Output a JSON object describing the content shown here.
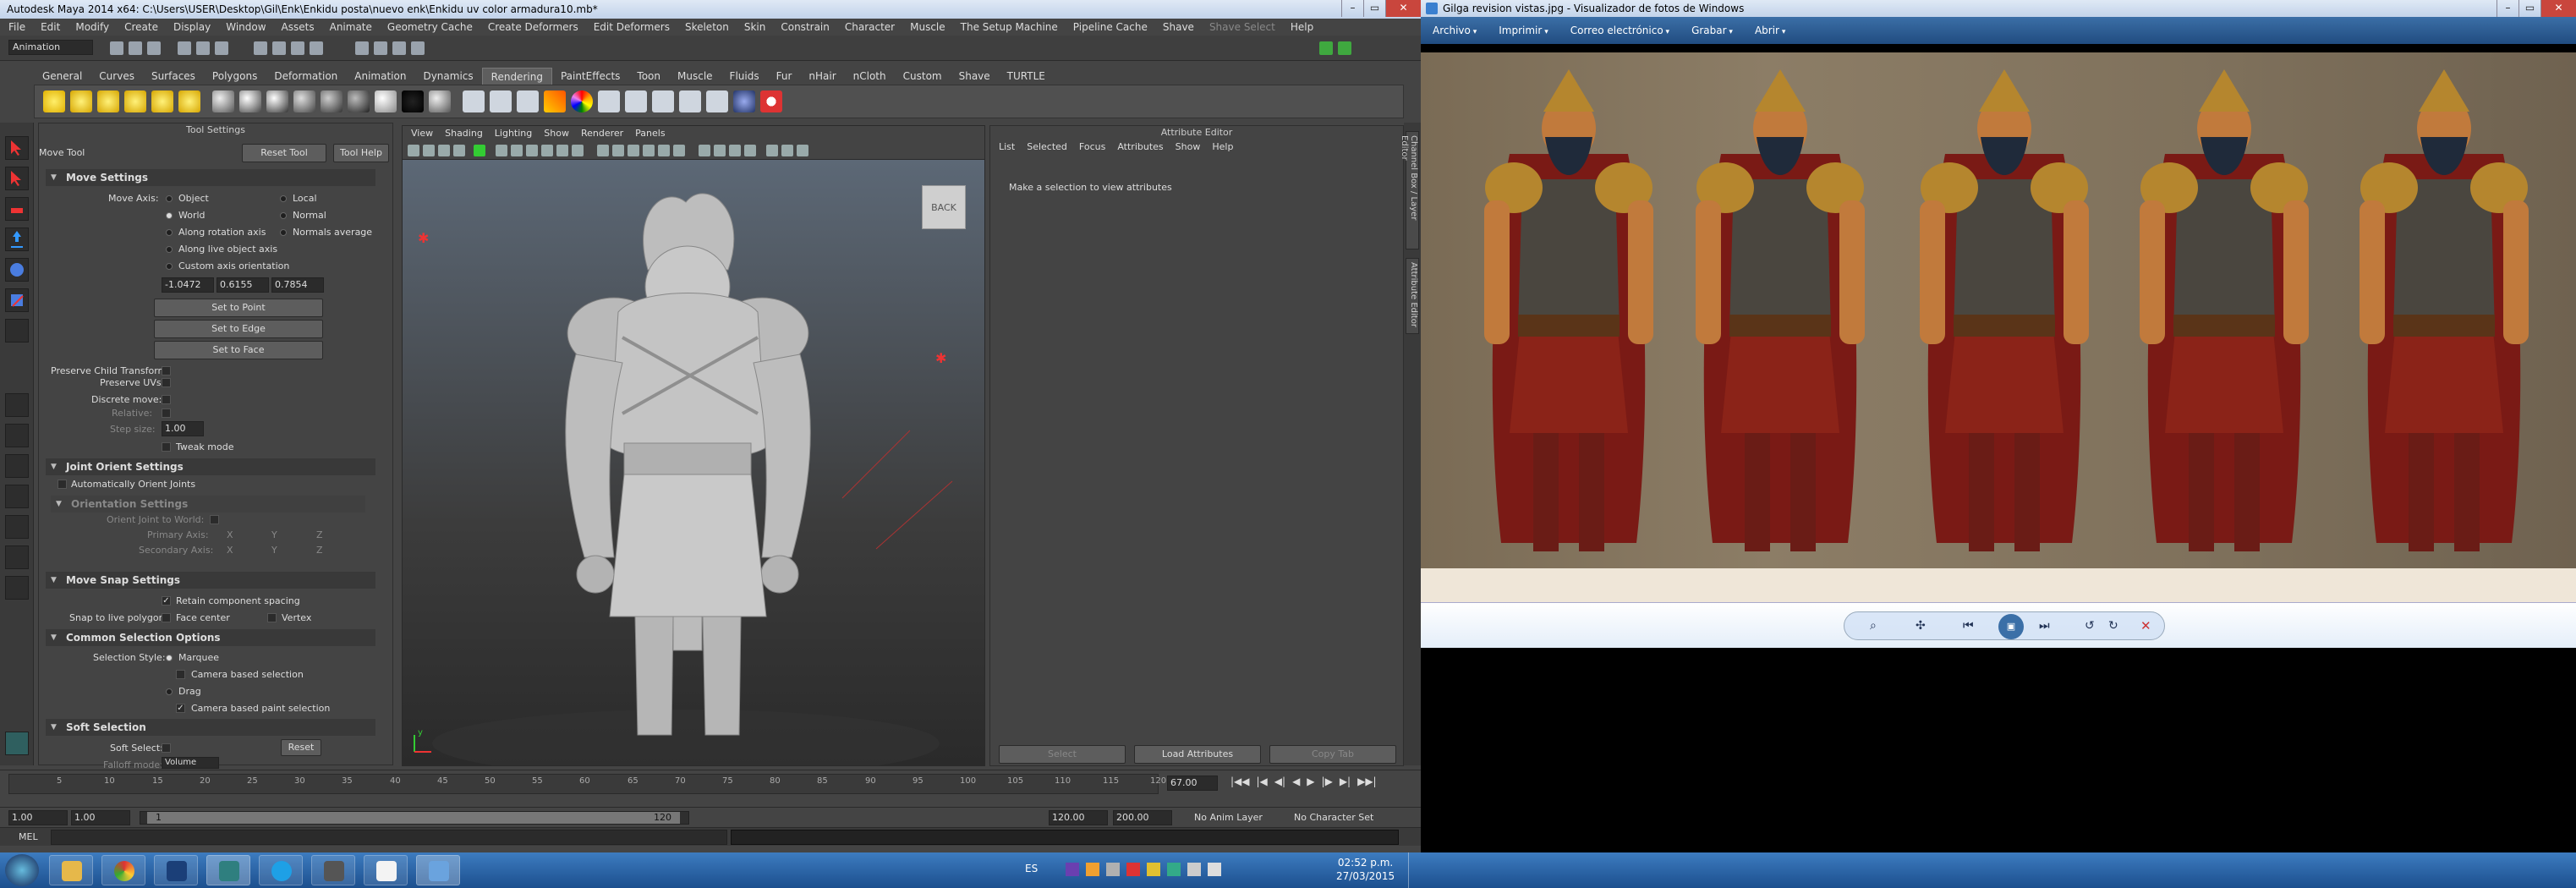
{
  "maya": {
    "title": "Autodesk Maya 2014 x64: C:\\Users\\USER\\Desktop\\Gil\\Enk\\Enkidu posta\\nuevo enk\\Enkidu uv color armadura10.mb*",
    "menu": [
      "File",
      "Edit",
      "Modify",
      "Create",
      "Display",
      "Window",
      "Assets",
      "Animate",
      "Geometry Cache",
      "Create Deformers",
      "Edit Deformers",
      "Skeleton",
      "Skin",
      "Constrain",
      "Character",
      "Muscle",
      "The Setup Machine",
      "Pipeline Cache",
      "Shave",
      "Shave Select",
      "Help"
    ],
    "mode": "Animation",
    "shelf_tabs": [
      "General",
      "Curves",
      "Surfaces",
      "Polygons",
      "Deformation",
      "Animation",
      "Dynamics",
      "Rendering",
      "PaintEffects",
      "Toon",
      "Muscle",
      "Fluids",
      "Fur",
      "nHair",
      "nCloth",
      "Custom",
      "Shave",
      "TURTLE"
    ],
    "active_shelf": "Rendering",
    "tool_settings": {
      "title": "Tool Settings",
      "tool_name": "Move Tool",
      "reset_label": "Reset Tool",
      "help_label": "Tool Help",
      "move_settings": "Move Settings",
      "move_axis_label": "Move Axis:",
      "axis_options": [
        "Object",
        "Local",
        "World",
        "Normal",
        "Along rotation axis",
        "Normals average",
        "Along live object axis",
        "Custom axis orientation"
      ],
      "axis_values": [
        "-1.0472",
        "0.6155",
        "0.7854"
      ],
      "set_to_point": "Set to Point",
      "set_to_edge": "Set to Edge",
      "set_to_face": "Set to Face",
      "preserve_child": "Preserve Child Transform",
      "preserve_uvs": "Preserve UVs",
      "discrete_move": "Discrete move:",
      "relative": "Relative:",
      "step_size": "Step size:",
      "step_value": "1.00",
      "tweak_mode": "Tweak mode",
      "joint_orient": "Joint Orient Settings",
      "auto_orient": "Automatically Orient Joints",
      "orientation_settings": "Orientation Settings",
      "orient_joint_world": "Orient Joint to World:",
      "primary_axis": "Primary Axis:",
      "secondary_axis": "Secondary Axis:",
      "xyz": [
        "X",
        "Y",
        "Z"
      ],
      "move_snap": "Move Snap Settings",
      "retain_spacing": "Retain component spacing",
      "snap_live": "Snap to live polygon:",
      "face_center": "Face center",
      "vertex": "Vertex",
      "common_selection": "Common Selection Options",
      "selection_style": "Selection Style:",
      "marquee": "Marquee",
      "camera_based": "Camera based selection",
      "drag": "Drag",
      "camera_paint": "Camera based paint selection",
      "soft_selection": "Soft Selection",
      "soft_select": "Soft Select:",
      "reset": "Reset",
      "falloff_mode": "Falloff mode:",
      "falloff_value": "Volume"
    },
    "viewport": {
      "menu": [
        "View",
        "Shading",
        "Lighting",
        "Show",
        "Renderer",
        "Panels"
      ],
      "view_cube": "BACK",
      "axis_y": "y"
    },
    "attribute_editor": {
      "title": "Attribute Editor",
      "menu": [
        "List",
        "Selected",
        "Focus",
        "Attributes",
        "Show",
        "Help"
      ],
      "message": "Make a selection to view attributes",
      "select_btn": "Select",
      "load_btn": "Load Attributes",
      "copy_btn": "Copy Tab"
    },
    "side_tabs": [
      "Channel Box / Layer Editor",
      "Attribute Editor"
    ],
    "time_slider": {
      "ticks": [
        "5",
        "10",
        "15",
        "20",
        "25",
        "30",
        "35",
        "40",
        "45",
        "50",
        "55",
        "60",
        "65",
        "70",
        "75",
        "80",
        "85",
        "90",
        "95",
        "100",
        "105",
        "110",
        "115",
        "120"
      ],
      "current_frame": "67.00"
    },
    "range": {
      "start": "1.00",
      "start2": "1.00",
      "range_start": "1",
      "range_end": "120",
      "end": "120.00",
      "end2": "200.00",
      "anim_layer": "No Anim Layer",
      "char_set": "No Character Set"
    },
    "command_line": "MEL"
  },
  "photo_viewer": {
    "title": "Gilga revision vistas.jpg - Visualizador de fotos de Windows",
    "menu": [
      "Archivo",
      "Imprimir",
      "Correo electrónico",
      "Grabar",
      "Abrir"
    ],
    "colors": {
      "cape": "#7a1a15",
      "armor": "#4a463f",
      "gold": "#b5862e",
      "skin": "#c17a3c",
      "beard": "#1f2a3a",
      "skirt": "#8b2318",
      "boots": "#6a1c16"
    }
  },
  "taskbar": {
    "lang": "ES",
    "time": "02:52 p.m.",
    "date": "27/03/2015"
  }
}
